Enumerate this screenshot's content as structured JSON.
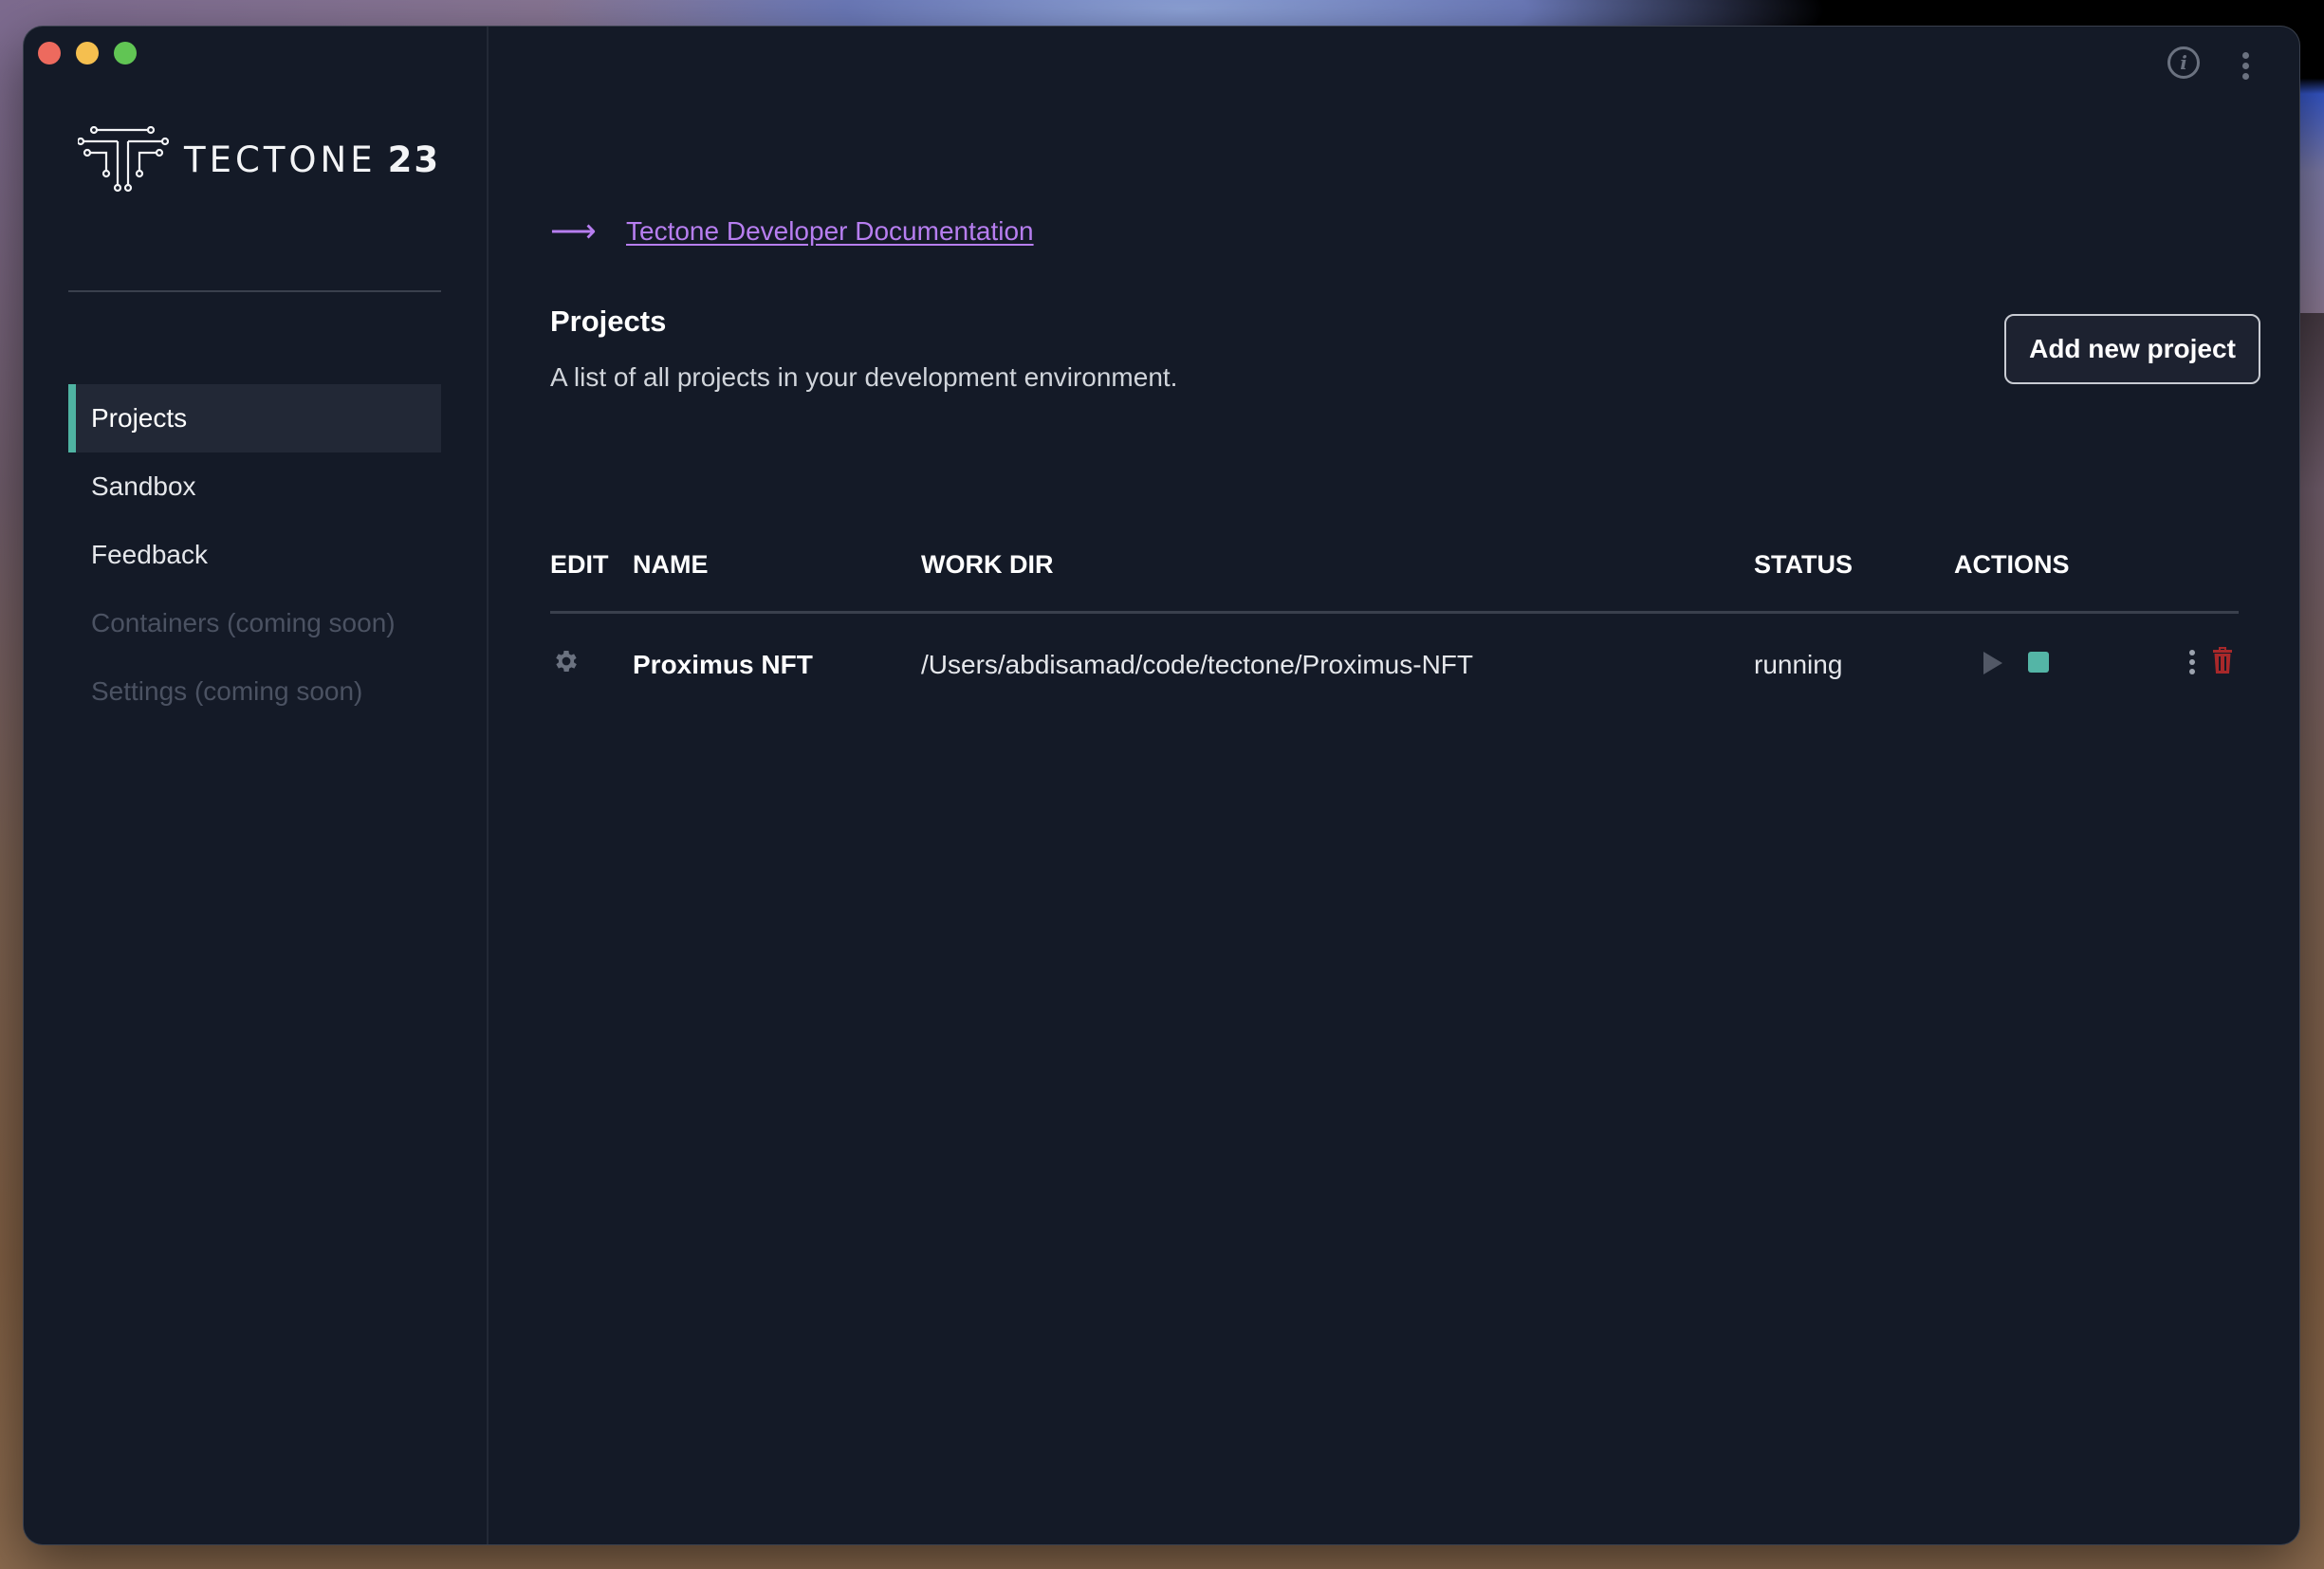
{
  "window": {
    "traffic_lights": [
      "close",
      "minimize",
      "zoom"
    ],
    "top_icons": [
      "info-icon",
      "more-vertical-icon"
    ]
  },
  "sidebar": {
    "logo": {
      "word": "TECTONE",
      "number": "23"
    },
    "items": [
      {
        "label": "Projects",
        "state": "active"
      },
      {
        "label": "Sandbox",
        "state": "normal"
      },
      {
        "label": "Feedback",
        "state": "normal"
      },
      {
        "label": "Containers (coming soon)",
        "state": "disabled"
      },
      {
        "label": "Settings (coming soon)",
        "state": "disabled"
      }
    ]
  },
  "main": {
    "doc_link": {
      "arrow": "⟶",
      "label": "Tectone Developer Documentation"
    },
    "title": "Projects",
    "subtitle": "A list of all projects in your development environment.",
    "add_button": "Add new project",
    "table": {
      "columns": [
        "EDIT",
        "NAME",
        "WORK DIR",
        "STATUS",
        "ACTIONS"
      ],
      "rows": [
        {
          "name": "Proximus NFT",
          "work_dir": "/Users/abdisamad/code/tectone/Proximus-NFT",
          "status": "running"
        }
      ]
    }
  },
  "colors": {
    "accent": "#4fb3a2",
    "link": "#b77ef0",
    "stop": "#54b5a6",
    "danger": "#a8282a",
    "background": "#141a27"
  }
}
